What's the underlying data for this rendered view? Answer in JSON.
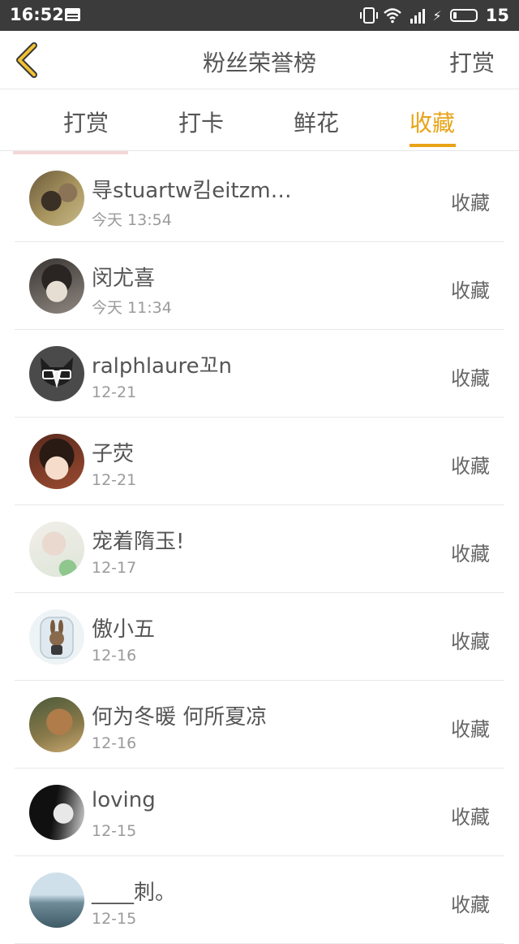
{
  "status_bar": {
    "time": "16:52",
    "battery": "15"
  },
  "header": {
    "title": "粉丝荣誉榜",
    "action_label": "打赏"
  },
  "tabs": [
    {
      "label": "打赏"
    },
    {
      "label": "打卡"
    },
    {
      "label": "鲜花"
    },
    {
      "label": "收藏"
    }
  ],
  "active_tab": "收藏",
  "colors": {
    "accent": "#e8a317",
    "status_bar": "#3b3b3b",
    "divider": "#e8e8e8"
  },
  "list": [
    {
      "name": "㝵stuartw킴eitzm…",
      "date": "今天 13:54",
      "action": "收藏"
    },
    {
      "name": "闵尤喜",
      "date": "今天 11:34",
      "action": "收藏"
    },
    {
      "name": "ralphlaure꼬n",
      "date": "12-21",
      "action": "收藏"
    },
    {
      "name": "子荧",
      "date": "12-21",
      "action": "收藏"
    },
    {
      "name": "宠着隋玉!",
      "date": "12-17",
      "action": "收藏"
    },
    {
      "name": "傲小五",
      "date": "12-16",
      "action": "收藏"
    },
    {
      "name": "何为冬暖 何所夏凉",
      "date": "12-16",
      "action": "收藏"
    },
    {
      "name": "loving",
      "date": "12-15",
      "action": "收藏"
    },
    {
      "name": "____刺。",
      "date": "12-15",
      "action": "收藏"
    }
  ]
}
